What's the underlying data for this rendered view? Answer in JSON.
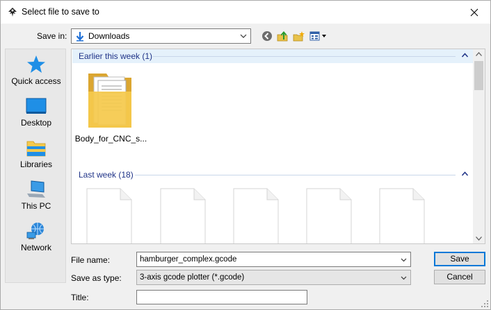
{
  "window": {
    "title": "Select file to save to",
    "close_icon": "close-icon",
    "app_icon": "inkscape-icon"
  },
  "toolbar": {
    "save_in_label": "Save in:",
    "save_in_value": "Downloads",
    "buttons": [
      "back-icon",
      "up-folder-icon",
      "new-folder-icon",
      "view-menu-icon"
    ]
  },
  "places": [
    {
      "label": "Quick access",
      "icon": "star-icon"
    },
    {
      "label": "Desktop",
      "icon": "desktop-icon"
    },
    {
      "label": "Libraries",
      "icon": "libraries-icon"
    },
    {
      "label": "This PC",
      "icon": "computer-icon"
    },
    {
      "label": "Network",
      "icon": "network-icon"
    }
  ],
  "groups": [
    {
      "header": "Earlier this week (1)",
      "items": [
        "Body_for_CNC_s..."
      ]
    },
    {
      "header": "Last week (18)"
    }
  ],
  "form": {
    "file_name_label": "File name:",
    "file_name_value": "hamburger_complex.gcode",
    "type_label": "Save as type:",
    "type_value": "3-axis gcode plotter (*.gcode)",
    "title_label": "Title:",
    "title_value": ""
  },
  "buttons": {
    "save": "Save",
    "cancel": "Cancel"
  },
  "colors": {
    "accent": "#0078d7",
    "group_header_text": "#1e3287",
    "selected_group_bg": "#e5f1fb",
    "folder": "#f5c94c"
  }
}
